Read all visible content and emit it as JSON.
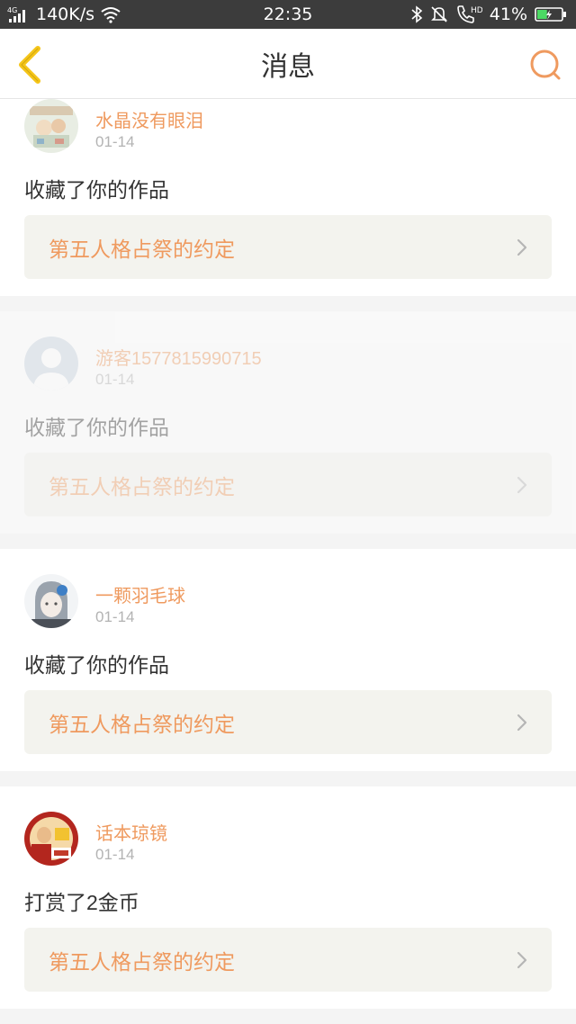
{
  "status_bar": {
    "network_type": "4G",
    "speed": "140K/s",
    "time": "22:35",
    "hd_label": "HD",
    "battery": "41%",
    "battery_level": 0.41
  },
  "header": {
    "title": "消息"
  },
  "colors": {
    "accent": "#ef9a5f",
    "back_arrow": "#f5c518",
    "card_link_bg": "#f3f3ee",
    "status_bar_bg": "#3c3c3c"
  },
  "icons": {
    "back": "chevron-left-icon",
    "search": "search-icon",
    "link": "chevron-right-icon"
  },
  "messages": [
    {
      "username": "水晶没有眼泪",
      "date": "01-14",
      "action": "收藏了你的作品",
      "work_title": "第五人格占祭的约定",
      "dimmed": false
    },
    {
      "username": "游客1577815990715",
      "date": "01-14",
      "action": "收藏了你的作品",
      "work_title": "第五人格占祭的约定",
      "dimmed": true
    },
    {
      "username": "一颗羽毛球",
      "date": "01-14",
      "action": "收藏了你的作品",
      "work_title": "第五人格占祭的约定",
      "dimmed": false
    },
    {
      "username": "话本琼镜",
      "date": "01-14",
      "action": "打赏了2金币",
      "work_title": "第五人格占祭的约定",
      "dimmed": false
    }
  ]
}
